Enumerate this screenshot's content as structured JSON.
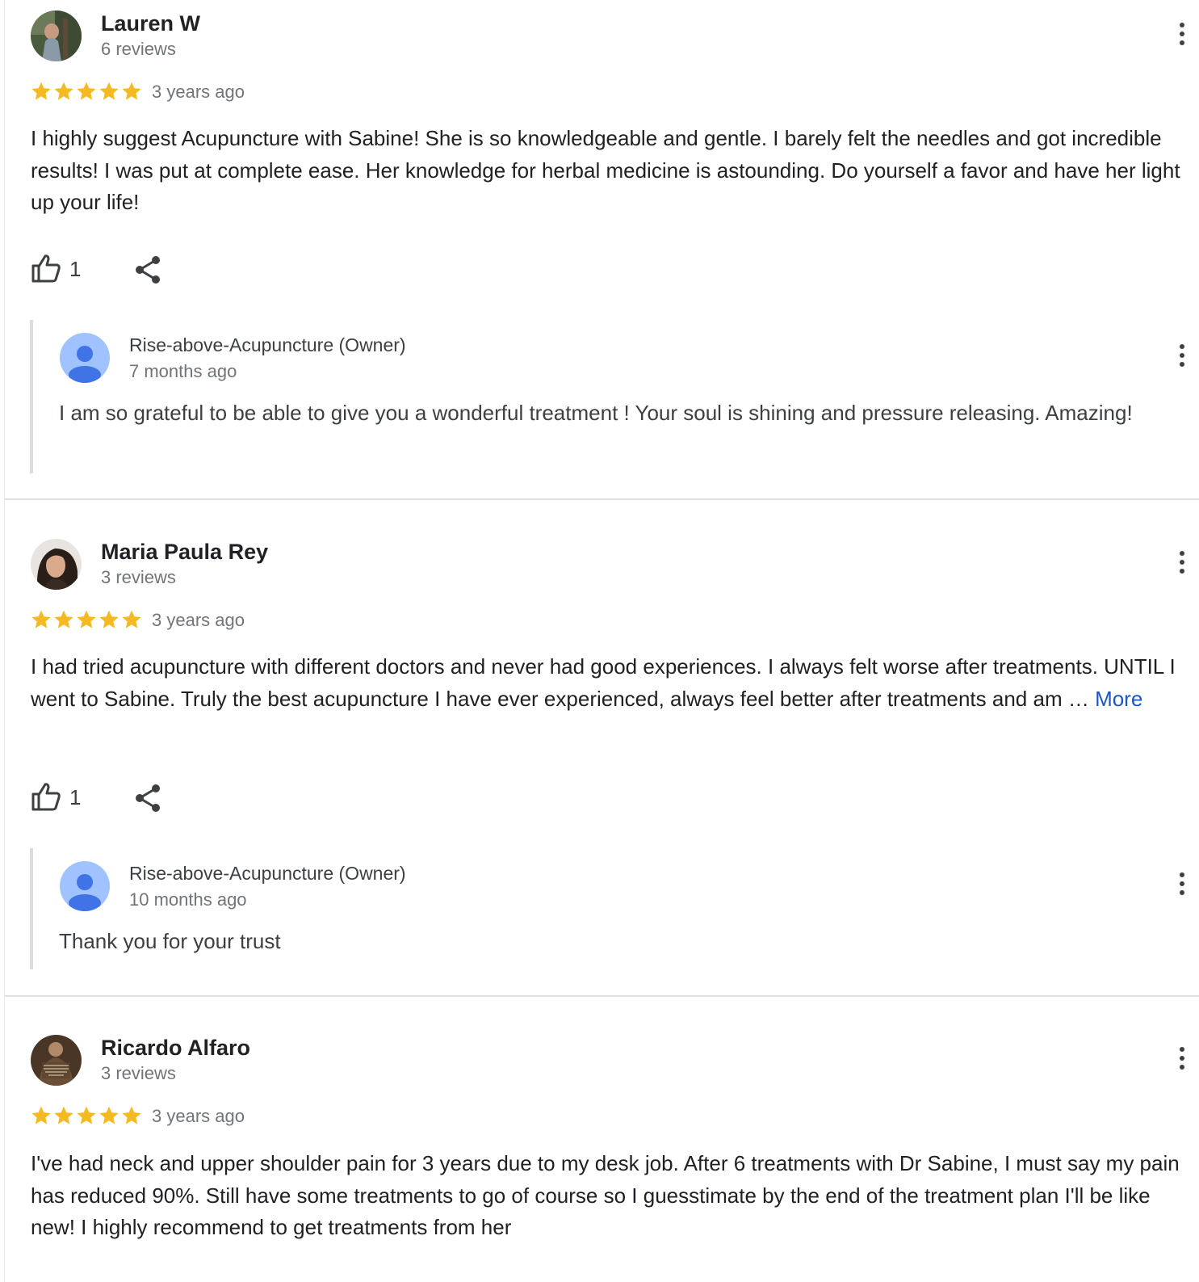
{
  "reviews": [
    {
      "name": "Lauren W",
      "count": "6 reviews",
      "rating": 5,
      "ago": "3 years ago",
      "text": "I highly suggest Acupuncture with Sabine! She is so knowledgeable and gentle. I barely felt the needles and got incredible results! I was put at complete ease. Her knowledge for herbal medicine is astounding. Do yourself a favor and have her light up your life!",
      "more": "",
      "likes": "1",
      "reply": {
        "name": "Rise-above-Acupuncture (Owner)",
        "ago": "7 months ago",
        "text": "I am so grateful to be able to give you a wonderful treatment ! Your soul is shining and pressure releasing. Amazing!"
      }
    },
    {
      "name": "Maria Paula Rey",
      "count": "3 reviews",
      "rating": 5,
      "ago": "3 years ago",
      "text": "I had tried acupuncture with different doctors and never had good experiences. I always felt worse after treatments. UNTIL I went to Sabine. Truly the best acupuncture I have ever experienced, always feel better after treatments and am … ",
      "more": "More",
      "likes": "1",
      "reply": {
        "name": "Rise-above-Acupuncture (Owner)",
        "ago": "10 months ago",
        "text": "Thank you for your trust"
      }
    },
    {
      "name": "Ricardo Alfaro",
      "count": "3 reviews",
      "rating": 5,
      "ago": "3 years ago",
      "text": "I've had neck and upper shoulder pain for 3 years due to my desk job. After 6 treatments with Dr Sabine, I must say my pain has reduced 90%. Still have some treatments to go of course so I guesstimate by the end of the treatment plan I'll be like new! I highly recommend to get treatments from her",
      "more": ""
    }
  ],
  "colors": {
    "star": "#f5b922",
    "link": "#1a56c8",
    "owner_avatar": "#a0c3ff",
    "owner_avatar_figure": "#3f73e6"
  }
}
